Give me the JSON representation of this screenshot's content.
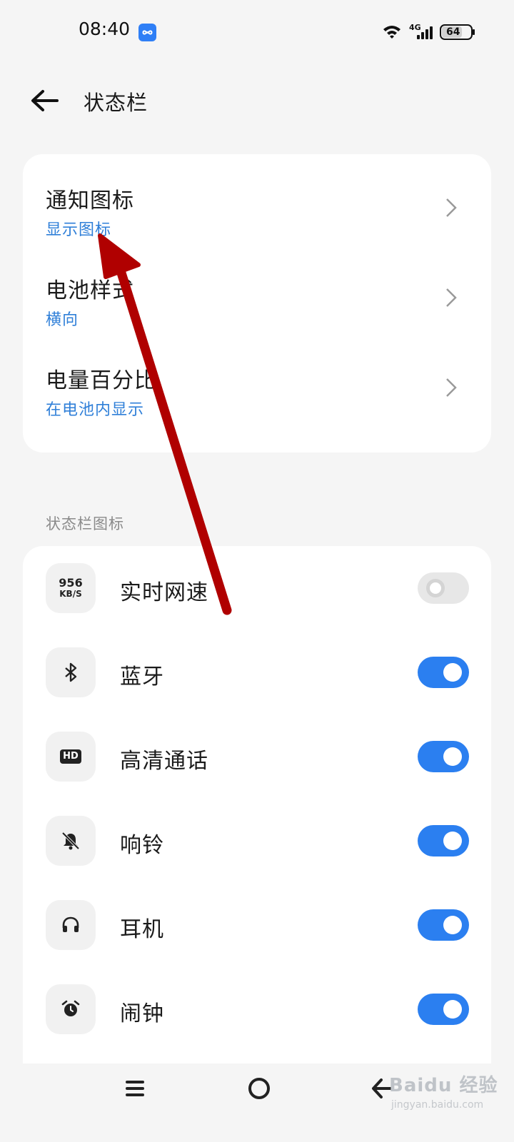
{
  "status_bar": {
    "time": "08:40",
    "network": "4G",
    "battery": "64"
  },
  "header": {
    "title": "状态栏"
  },
  "settings": [
    {
      "title": "通知图标",
      "subtitle": "显示图标"
    },
    {
      "title": "电池样式",
      "subtitle": "横向"
    },
    {
      "title": "电量百分比",
      "subtitle": "在电池内显示"
    }
  ],
  "section": {
    "label": "状态栏图标"
  },
  "icons": [
    {
      "label": "实时网速",
      "icon": "network-speed-icon",
      "speed_value": "956",
      "speed_unit": "KB/S",
      "enabled": false
    },
    {
      "label": "蓝牙",
      "icon": "bluetooth-icon",
      "enabled": true
    },
    {
      "label": "高清通话",
      "icon": "hd-call-icon",
      "badge": "HD",
      "enabled": true
    },
    {
      "label": "响铃",
      "icon": "bell-off-icon",
      "enabled": true
    },
    {
      "label": "耳机",
      "icon": "headphones-icon",
      "enabled": true
    },
    {
      "label": "闹钟",
      "icon": "alarm-clock-icon",
      "enabled": true
    }
  ],
  "watermark": {
    "brand": "Baidu 经验",
    "url": "jingyan.baidu.com"
  },
  "colors": {
    "accent": "#2b7ff0",
    "link": "#2f7fd8",
    "annotation": "#b00000"
  }
}
